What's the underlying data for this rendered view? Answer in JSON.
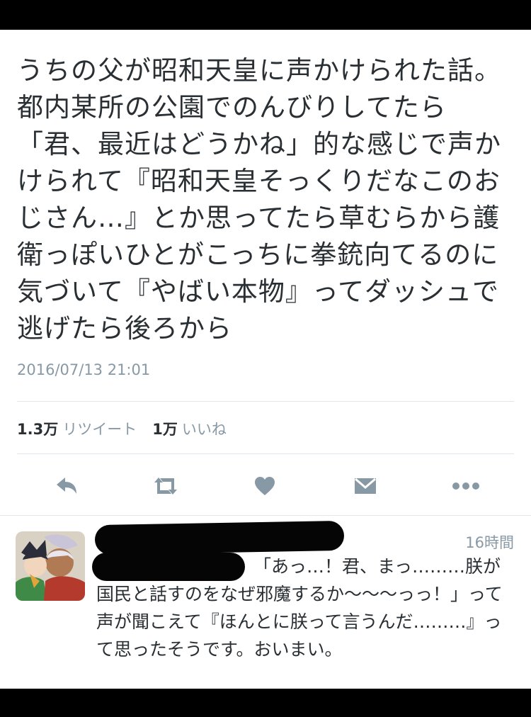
{
  "tweet": {
    "text": "うちの父が昭和天皇に声かけられた話。都内某所の公園でのんびりしてたら「君、最近はどうかね」的な感じで声かけられて『昭和天皇そっくりだなこのおじさん…』とか思ってたら草むらから護衛っぽいひとがこっちに拳銃向てるのに気づいて『やばい本物』ってダッシュで逃げたら後ろから",
    "timestamp": "2016/07/13 21:01",
    "retweet_count": "1.3万",
    "retweet_label": "リツイート",
    "like_count": "1万",
    "like_label": "いいね"
  },
  "actions": [
    {
      "icon": "reply-icon"
    },
    {
      "icon": "retweet-icon"
    },
    {
      "icon": "heart-icon"
    },
    {
      "icon": "mail-icon"
    },
    {
      "icon": "more-icon"
    }
  ],
  "reply": {
    "time": "16時間",
    "text": "「あっ…！君、まっ………朕が国民と話すのをなぜ邪魔するか〜〜〜っっ！」って声が聞こえて『ほんとに朕って言うんだ………』って思ったそうです。おいまい。"
  },
  "colors": {
    "text": "#292f33",
    "muted": "#8899a6",
    "icon": "#8899a6",
    "divider": "#e1e8ed"
  }
}
